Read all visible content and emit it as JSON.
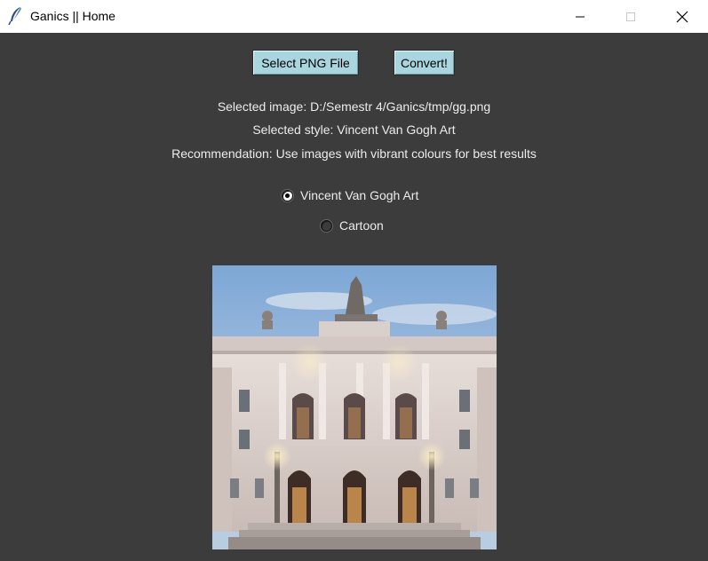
{
  "window": {
    "title": "Ganics || Home",
    "icon": "feather-icon"
  },
  "buttons": {
    "select": "Select PNG File",
    "convert": "Convert!"
  },
  "info": {
    "selected_image": "Selected image: D:/Semestr 4/Ganics/tmp/gg.png",
    "selected_style": "Selected style: Vincent Van Gogh Art",
    "recommendation": "Recommendation: Use images with vibrant colours for best results"
  },
  "style_options": [
    {
      "label": "Vincent Van Gogh Art",
      "checked": true
    },
    {
      "label": "Cartoon",
      "checked": false
    }
  ],
  "colors": {
    "background": "#3c3c3c",
    "button": "#a9d5df",
    "text": "#ececec"
  }
}
